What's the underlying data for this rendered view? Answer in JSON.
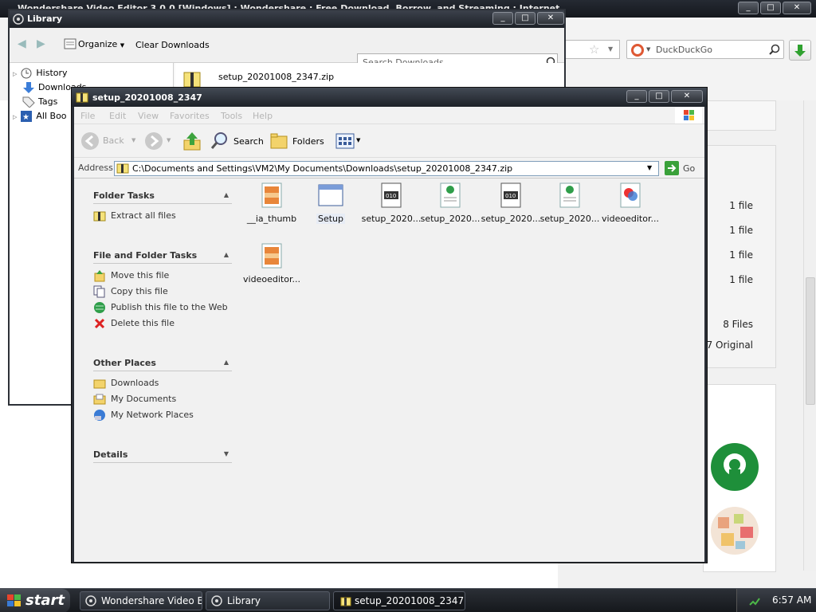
{
  "firefox": {
    "title": "Wondershare Video Editor 3.0.0 [Windows] : Wondershare : Free Download, Borrow, and Streaming : Internet Archive - Mozil",
    "search_engine": "DuckDuckGo",
    "file_counts": [
      "1 file",
      "1 file",
      "1 file",
      "1 file"
    ],
    "files_total": "8 Files",
    "original": "7 Original"
  },
  "library": {
    "title": "Library",
    "organize": "Organize",
    "clear_downloads": "Clear Downloads",
    "search_placeholder": "Search Downloads",
    "sidebar": [
      "History",
      "Downloads",
      "Tags",
      "All Boo"
    ],
    "download_name": "setup_20201008_2347.zip"
  },
  "explorer": {
    "title": "setup_20201008_2347",
    "menu": [
      "File",
      "Edit",
      "View",
      "Favorites",
      "Tools",
      "Help"
    ],
    "toolbar": {
      "back": "Back",
      "search": "Search",
      "folders": "Folders"
    },
    "address_label": "Address",
    "address": "C:\\Documents and Settings\\VM2\\My Documents\\Downloads\\setup_20201008_2347.zip",
    "go": "Go",
    "folder_tasks": {
      "header": "Folder Tasks",
      "items": [
        "Extract all files"
      ]
    },
    "file_folder_tasks": {
      "header": "File and Folder Tasks",
      "items": [
        "Move this file",
        "Copy this file",
        "Publish this file to the Web",
        "Delete this file"
      ]
    },
    "other_places": {
      "header": "Other Places",
      "items": [
        "Downloads",
        "My Documents",
        "My Network Places"
      ]
    },
    "details": {
      "header": "Details"
    },
    "files": [
      {
        "name": "__ia_thumb",
        "icon": "image-file-icon"
      },
      {
        "name": "Setup",
        "icon": "application-icon"
      },
      {
        "name": "setup_2020...",
        "icon": "data-file-icon"
      },
      {
        "name": "setup_2020...",
        "icon": "web-file-icon"
      },
      {
        "name": "setup_2020...",
        "icon": "data-file-icon"
      },
      {
        "name": "setup_2020...",
        "icon": "web-file-icon"
      },
      {
        "name": "videoeditor...",
        "icon": "media-file-icon"
      },
      {
        "name": "videoeditor...",
        "icon": "image-file-icon"
      }
    ]
  },
  "taskbar": {
    "start": "start",
    "tasks": [
      "Wondershare Video E...",
      "Library",
      "setup_20201008_2347"
    ],
    "clock": "6:57 AM"
  }
}
